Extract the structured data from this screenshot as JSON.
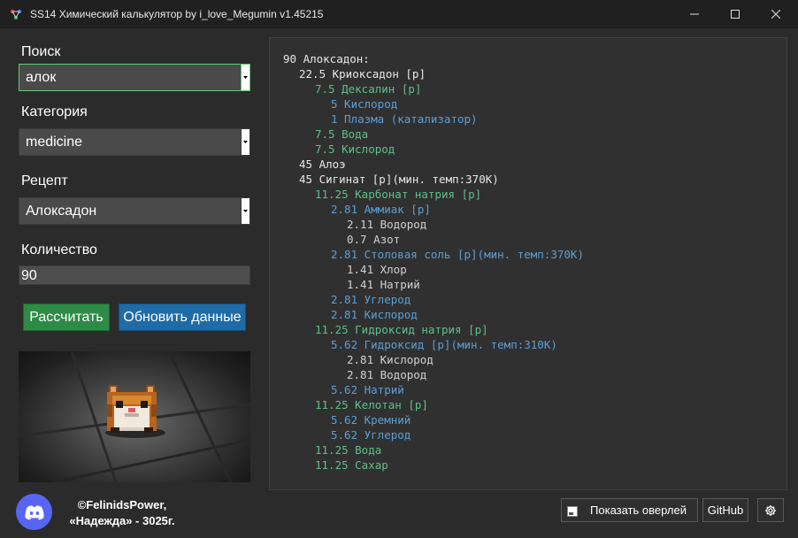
{
  "window": {
    "title": "SS14 Химический калькулятор by i_love_Megumin v1.45215"
  },
  "colors": {
    "depth0": "#e8e8e8",
    "depth1": "#e8e8e8",
    "depth2": "#5fbf8a",
    "depth3": "#5c9fd4",
    "depth4": "#d0d0d0"
  },
  "form": {
    "search_label": "Поиск",
    "search_value": "алок",
    "category_label": "Категория",
    "category_value": "medicine",
    "recipe_label": "Рецепт",
    "recipe_value": "Алоксадон",
    "quantity_label": "Количество",
    "quantity_value": "90",
    "calculate_label": "Рассчитать",
    "update_label": "Обновить данные"
  },
  "footer": {
    "credit_line1": "©FelinidsPower,",
    "credit_line2": "«Надежда» - 3025г.",
    "overlay_label": "Показать оверлей",
    "github_label": "GitHub",
    "settings_icon": "gear-icon",
    "discord_icon": "discord-icon"
  },
  "output": {
    "lines": [
      {
        "depth": 0,
        "text": "90 Алоксадон:"
      },
      {
        "depth": 1,
        "text": "22.5 Криоксадон [р]"
      },
      {
        "depth": 2,
        "text": "7.5 Дексалин [р]"
      },
      {
        "depth": 3,
        "text": "5 Кислород"
      },
      {
        "depth": 3,
        "text": "1 Плазма (катализатор)"
      },
      {
        "depth": 2,
        "text": "7.5 Вода"
      },
      {
        "depth": 2,
        "text": "7.5 Кислород"
      },
      {
        "depth": 1,
        "text": "45 Алоэ"
      },
      {
        "depth": 1,
        "text": "45 Сигинат [р](мин. темп:370K)"
      },
      {
        "depth": 2,
        "text": "11.25 Карбонат натрия [р]"
      },
      {
        "depth": 3,
        "text": "2.81 Аммиак [р]"
      },
      {
        "depth": 4,
        "text": "2.11 Водород"
      },
      {
        "depth": 4,
        "text": "0.7 Азот"
      },
      {
        "depth": 3,
        "text": "2.81 Столовая соль [р](мин. темп:370K)"
      },
      {
        "depth": 4,
        "text": "1.41 Хлор"
      },
      {
        "depth": 4,
        "text": "1.41 Натрий"
      },
      {
        "depth": 3,
        "text": "2.81 Углерод"
      },
      {
        "depth": 3,
        "text": "2.81 Кислород"
      },
      {
        "depth": 2,
        "text": "11.25 Гидроксид натрия [р]"
      },
      {
        "depth": 3,
        "text": "5.62 Гидроксид [р](мин. темп:310K)"
      },
      {
        "depth": 4,
        "text": "2.81 Кислород"
      },
      {
        "depth": 4,
        "text": "2.81 Водород"
      },
      {
        "depth": 3,
        "text": "5.62 Натрий"
      },
      {
        "depth": 2,
        "text": "11.25 Келотан [р]"
      },
      {
        "depth": 3,
        "text": "5.62 Кремний"
      },
      {
        "depth": 3,
        "text": "5.62 Углерод"
      },
      {
        "depth": 2,
        "text": "11.25 Вода"
      },
      {
        "depth": 2,
        "text": "11.25 Сахар"
      }
    ]
  }
}
